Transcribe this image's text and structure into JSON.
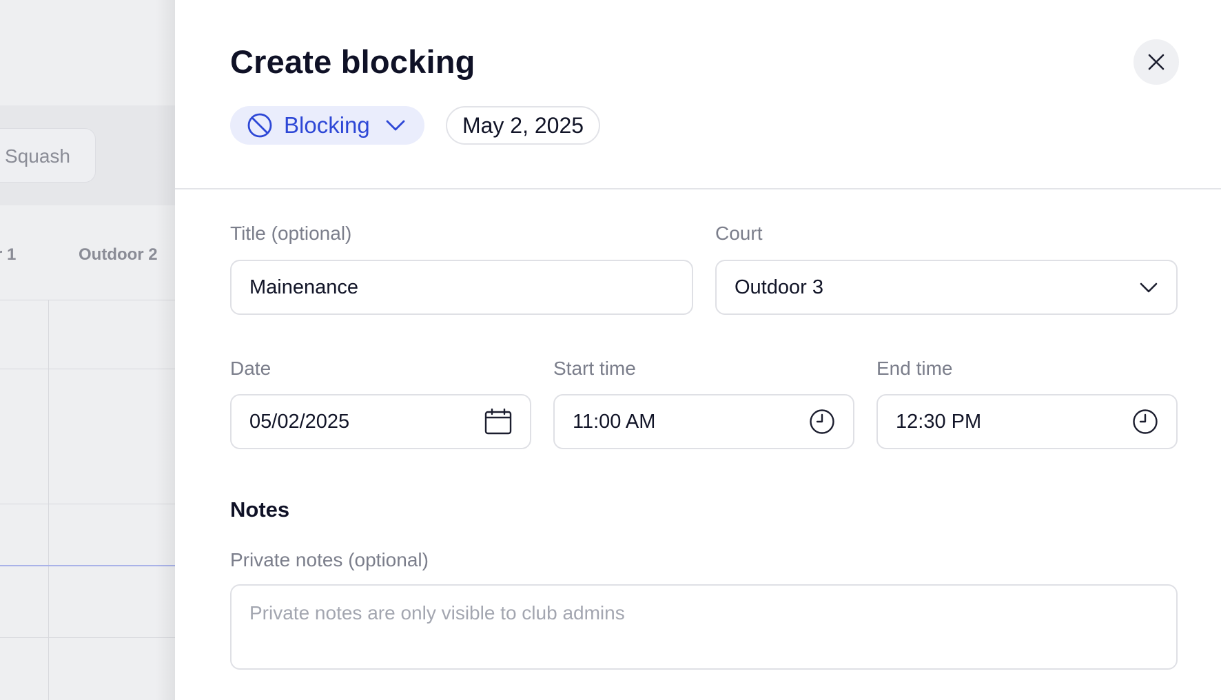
{
  "background": {
    "filter_chip_label": "Squash",
    "columns": [
      "r 1",
      "Outdoor 2"
    ]
  },
  "panel": {
    "title": "Create blocking",
    "close_icon": "close-icon",
    "type_selector": {
      "label": "Blocking",
      "icon": "blocked-icon",
      "accent_color": "#2d47d6"
    },
    "date_chip": "May 2, 2025"
  },
  "form": {
    "title": {
      "label": "Title (optional)",
      "value": "Mainenance"
    },
    "court": {
      "label": "Court",
      "value": "Outdoor 3"
    },
    "date": {
      "label": "Date",
      "value": "05/02/2025",
      "icon": "calendar-icon"
    },
    "start_time": {
      "label": "Start time",
      "value": "11:00 AM",
      "icon": "clock-icon"
    },
    "end_time": {
      "label": "End time",
      "value": "12:30 PM",
      "icon": "clock-icon"
    },
    "notes": {
      "section_title": "Notes",
      "label": "Private notes (optional)",
      "placeholder": "Private notes are only visible to club admins",
      "value": ""
    }
  }
}
